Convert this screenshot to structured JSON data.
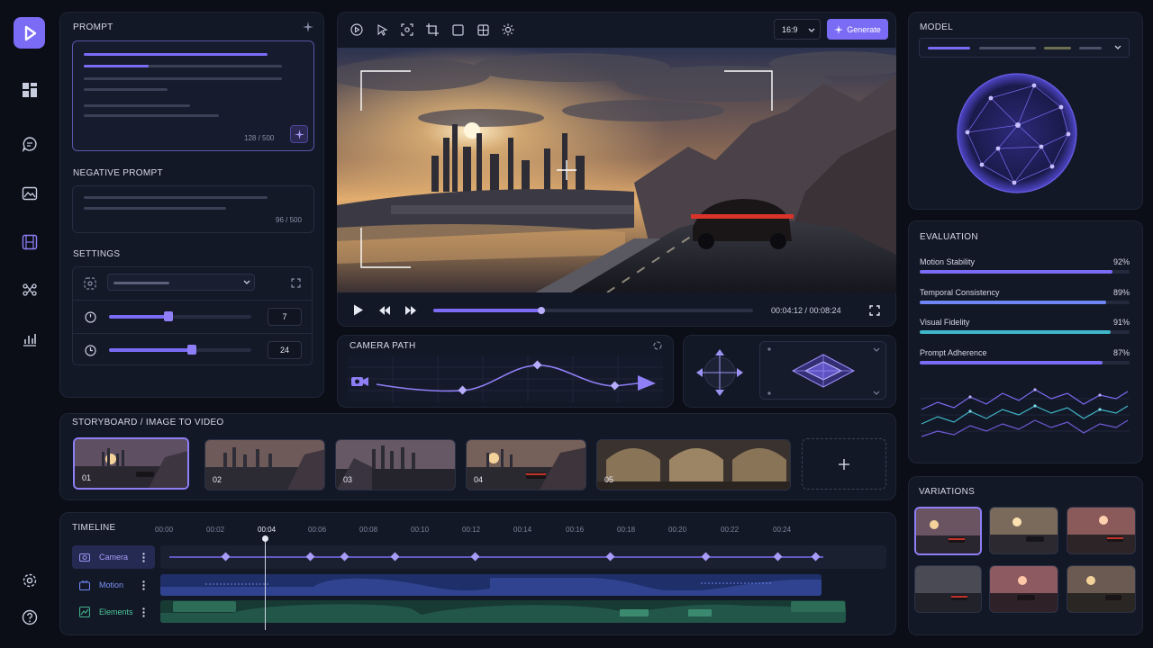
{
  "prompt": {
    "title": "PROMPT",
    "counter": "128 / 500"
  },
  "negative_prompt": {
    "title": "NEGATIVE PROMPT",
    "counter": "96 / 500"
  },
  "settings": {
    "title": "SETTINGS",
    "value_a": "7",
    "value_b": "24",
    "slider_a": 0.42,
    "slider_b": 0.58
  },
  "toolbar": {
    "aspect": "16:9",
    "generate_label": "Generate"
  },
  "player": {
    "time": "00:04:12 / 00:08:24",
    "progress": 0.34
  },
  "camera_path": {
    "title": "CAMERA PATH"
  },
  "storyboard": {
    "title": "STORYBOARD / IMAGE TO VIDEO",
    "items": [
      {
        "num": "01"
      },
      {
        "num": "02"
      },
      {
        "num": "03"
      },
      {
        "num": "04"
      },
      {
        "num": "05"
      }
    ]
  },
  "timeline": {
    "title": "TIMELINE",
    "ticks": [
      "00:00",
      "00:02",
      "00:04",
      "00:06",
      "00:08",
      "00:10",
      "00:12",
      "00:14",
      "00:16",
      "00:18",
      "00:20",
      "00:22",
      "00:24"
    ],
    "tracks": [
      {
        "label": "Camera"
      },
      {
        "label": "Motion"
      },
      {
        "label": "Elements"
      }
    ]
  },
  "model": {
    "title": "MODEL"
  },
  "evaluation": {
    "title": "EVALUATION",
    "metrics": [
      {
        "label": "Motion Stability",
        "value": "92%",
        "fraction": 0.92,
        "color": "#7b6cf6"
      },
      {
        "label": "Temporal Consistency",
        "value": "89%",
        "fraction": 0.89,
        "color": "#6f86f6"
      },
      {
        "label": "Visual Fidelity",
        "value": "91%",
        "fraction": 0.91,
        "color": "#3fb6c9"
      },
      {
        "label": "Prompt Adherence",
        "value": "87%",
        "fraction": 0.87,
        "color": "#7b6cf6"
      }
    ]
  },
  "variations": {
    "title": "VARIATIONS"
  },
  "icons": {
    "logo": "play-logo-icon",
    "rail": [
      "dashboard-icon",
      "chat-icon",
      "image-icon",
      "film-icon",
      "nodes-icon",
      "chart-icon",
      "settings-icon",
      "help-icon"
    ],
    "toolbar": [
      "play-tool-icon",
      "cursor-icon",
      "focus-icon",
      "crop-icon",
      "frame-icon",
      "grid-icon",
      "sun-icon"
    ]
  },
  "colors": {
    "accent": "#7b6cf6",
    "background": "#0b0e17",
    "panel": "#131826"
  }
}
